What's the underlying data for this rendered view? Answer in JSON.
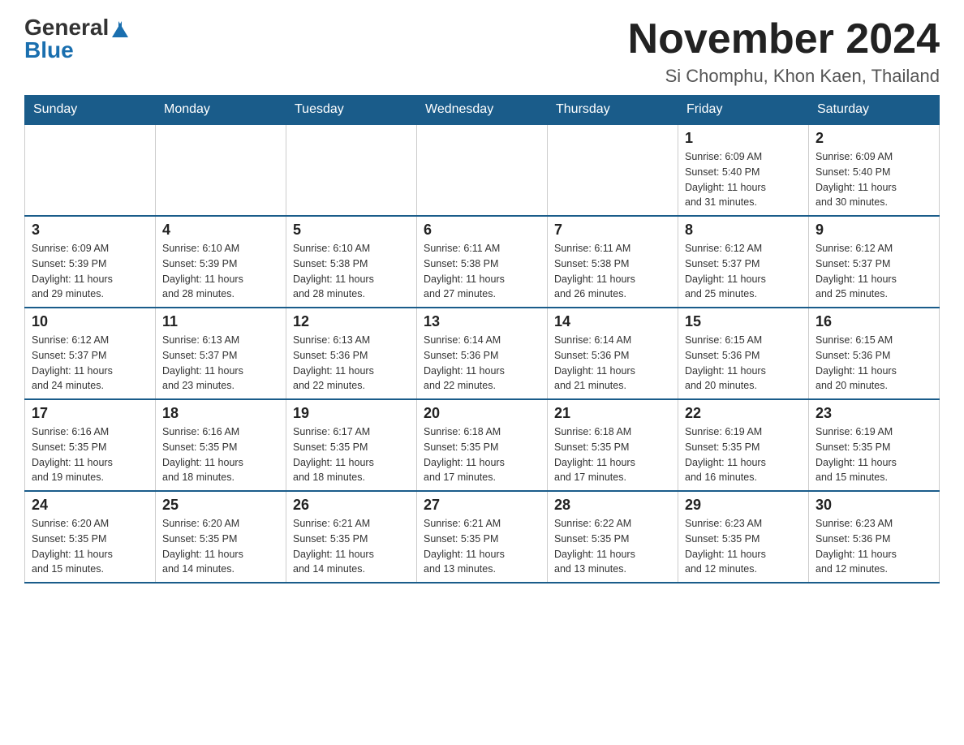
{
  "header": {
    "logo_general": "General",
    "logo_blue": "Blue",
    "title": "November 2024",
    "location": "Si Chomphu, Khon Kaen, Thailand"
  },
  "days_of_week": [
    "Sunday",
    "Monday",
    "Tuesday",
    "Wednesday",
    "Thursday",
    "Friday",
    "Saturday"
  ],
  "weeks": [
    [
      {
        "day": "",
        "info": ""
      },
      {
        "day": "",
        "info": ""
      },
      {
        "day": "",
        "info": ""
      },
      {
        "day": "",
        "info": ""
      },
      {
        "day": "",
        "info": ""
      },
      {
        "day": "1",
        "info": "Sunrise: 6:09 AM\nSunset: 5:40 PM\nDaylight: 11 hours\nand 31 minutes."
      },
      {
        "day": "2",
        "info": "Sunrise: 6:09 AM\nSunset: 5:40 PM\nDaylight: 11 hours\nand 30 minutes."
      }
    ],
    [
      {
        "day": "3",
        "info": "Sunrise: 6:09 AM\nSunset: 5:39 PM\nDaylight: 11 hours\nand 29 minutes."
      },
      {
        "day": "4",
        "info": "Sunrise: 6:10 AM\nSunset: 5:39 PM\nDaylight: 11 hours\nand 28 minutes."
      },
      {
        "day": "5",
        "info": "Sunrise: 6:10 AM\nSunset: 5:38 PM\nDaylight: 11 hours\nand 28 minutes."
      },
      {
        "day": "6",
        "info": "Sunrise: 6:11 AM\nSunset: 5:38 PM\nDaylight: 11 hours\nand 27 minutes."
      },
      {
        "day": "7",
        "info": "Sunrise: 6:11 AM\nSunset: 5:38 PM\nDaylight: 11 hours\nand 26 minutes."
      },
      {
        "day": "8",
        "info": "Sunrise: 6:12 AM\nSunset: 5:37 PM\nDaylight: 11 hours\nand 25 minutes."
      },
      {
        "day": "9",
        "info": "Sunrise: 6:12 AM\nSunset: 5:37 PM\nDaylight: 11 hours\nand 25 minutes."
      }
    ],
    [
      {
        "day": "10",
        "info": "Sunrise: 6:12 AM\nSunset: 5:37 PM\nDaylight: 11 hours\nand 24 minutes."
      },
      {
        "day": "11",
        "info": "Sunrise: 6:13 AM\nSunset: 5:37 PM\nDaylight: 11 hours\nand 23 minutes."
      },
      {
        "day": "12",
        "info": "Sunrise: 6:13 AM\nSunset: 5:36 PM\nDaylight: 11 hours\nand 22 minutes."
      },
      {
        "day": "13",
        "info": "Sunrise: 6:14 AM\nSunset: 5:36 PM\nDaylight: 11 hours\nand 22 minutes."
      },
      {
        "day": "14",
        "info": "Sunrise: 6:14 AM\nSunset: 5:36 PM\nDaylight: 11 hours\nand 21 minutes."
      },
      {
        "day": "15",
        "info": "Sunrise: 6:15 AM\nSunset: 5:36 PM\nDaylight: 11 hours\nand 20 minutes."
      },
      {
        "day": "16",
        "info": "Sunrise: 6:15 AM\nSunset: 5:36 PM\nDaylight: 11 hours\nand 20 minutes."
      }
    ],
    [
      {
        "day": "17",
        "info": "Sunrise: 6:16 AM\nSunset: 5:35 PM\nDaylight: 11 hours\nand 19 minutes."
      },
      {
        "day": "18",
        "info": "Sunrise: 6:16 AM\nSunset: 5:35 PM\nDaylight: 11 hours\nand 18 minutes."
      },
      {
        "day": "19",
        "info": "Sunrise: 6:17 AM\nSunset: 5:35 PM\nDaylight: 11 hours\nand 18 minutes."
      },
      {
        "day": "20",
        "info": "Sunrise: 6:18 AM\nSunset: 5:35 PM\nDaylight: 11 hours\nand 17 minutes."
      },
      {
        "day": "21",
        "info": "Sunrise: 6:18 AM\nSunset: 5:35 PM\nDaylight: 11 hours\nand 17 minutes."
      },
      {
        "day": "22",
        "info": "Sunrise: 6:19 AM\nSunset: 5:35 PM\nDaylight: 11 hours\nand 16 minutes."
      },
      {
        "day": "23",
        "info": "Sunrise: 6:19 AM\nSunset: 5:35 PM\nDaylight: 11 hours\nand 15 minutes."
      }
    ],
    [
      {
        "day": "24",
        "info": "Sunrise: 6:20 AM\nSunset: 5:35 PM\nDaylight: 11 hours\nand 15 minutes."
      },
      {
        "day": "25",
        "info": "Sunrise: 6:20 AM\nSunset: 5:35 PM\nDaylight: 11 hours\nand 14 minutes."
      },
      {
        "day": "26",
        "info": "Sunrise: 6:21 AM\nSunset: 5:35 PM\nDaylight: 11 hours\nand 14 minutes."
      },
      {
        "day": "27",
        "info": "Sunrise: 6:21 AM\nSunset: 5:35 PM\nDaylight: 11 hours\nand 13 minutes."
      },
      {
        "day": "28",
        "info": "Sunrise: 6:22 AM\nSunset: 5:35 PM\nDaylight: 11 hours\nand 13 minutes."
      },
      {
        "day": "29",
        "info": "Sunrise: 6:23 AM\nSunset: 5:35 PM\nDaylight: 11 hours\nand 12 minutes."
      },
      {
        "day": "30",
        "info": "Sunrise: 6:23 AM\nSunset: 5:36 PM\nDaylight: 11 hours\nand 12 minutes."
      }
    ]
  ]
}
